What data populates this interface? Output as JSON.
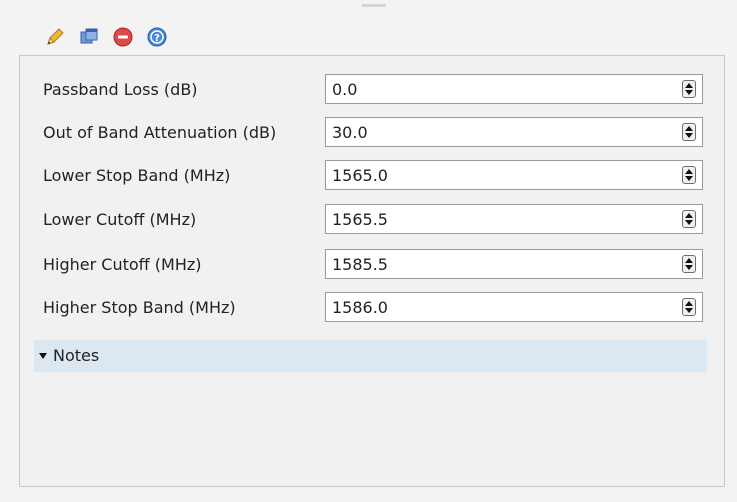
{
  "toolbar": {
    "buttons": [
      {
        "icon": "pencil-icon",
        "color": "#e0a020"
      },
      {
        "icon": "dock-window-icon",
        "color": "#4a78c0"
      },
      {
        "icon": "remove-icon",
        "color": "#d83a3a"
      },
      {
        "icon": "help-icon",
        "color": "#3a78d0"
      }
    ]
  },
  "form": {
    "fields": [
      {
        "label": "Passband Loss (dB)",
        "value": "0.0"
      },
      {
        "label": "Out of Band Attenuation (dB)",
        "value": "30.0"
      },
      {
        "label": "Lower Stop Band (MHz)",
        "value": "1565.0"
      },
      {
        "label": "Lower Cutoff (MHz)",
        "value": "1565.5"
      },
      {
        "label": "Higher Cutoff (MHz)",
        "value": "1585.5"
      },
      {
        "label": "Higher Stop Band (MHz)",
        "value": "1586.0"
      }
    ]
  },
  "notes": {
    "label": "Notes",
    "expanded": true,
    "header_color": "#dbe7f1"
  }
}
